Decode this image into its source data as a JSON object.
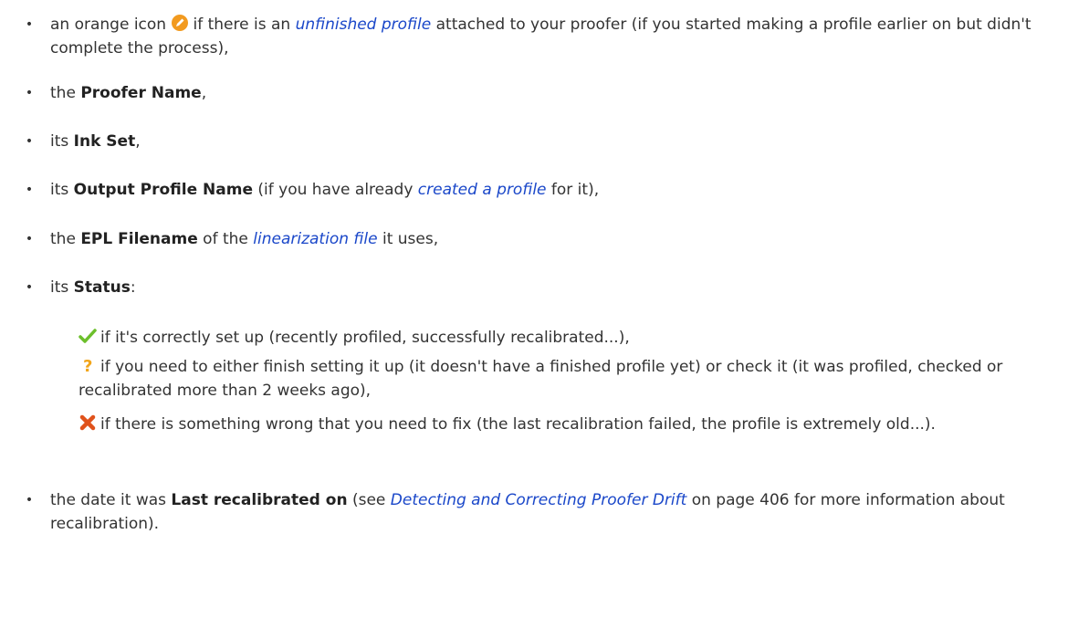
{
  "bullets": [
    {
      "pre": "an orange icon",
      "mid1": "if there is an",
      "link": "unfinished profile",
      "post": "attached to your proofer (if you started making a profile earlier on but didn't complete the process),",
      "icon": "orange-pencil-icon",
      "colors": {
        "icon": "#f29a1f"
      }
    },
    {
      "pre": "the",
      "bold": "Proofer Name",
      "post": ","
    },
    {
      "pre": "its",
      "bold": "Ink Set",
      "post": ","
    },
    {
      "pre": "its",
      "bold": "Output Profile Name",
      "mid": "(if you have already",
      "link": "created a profile",
      "post": "for it),"
    },
    {
      "pre": "the",
      "bold": "EPL Filename",
      "mid": "of the",
      "link": "linearization file",
      "post": "it uses,"
    },
    {
      "pre": "its",
      "bold": "Status",
      "post": ":"
    },
    {
      "pre": "the date it was",
      "bold": "Last recalibrated on",
      "mid": "(see",
      "link": "Detecting and Correcting Proofer Drift",
      "post": "on page 406 for more information about recalibration)."
    }
  ],
  "status_items": [
    {
      "icon": "green-check-icon",
      "text": "if it's correctly set up (recently profiled, successfully recalibrated...),"
    },
    {
      "icon": "question-mark-icon",
      "text": "if you need to either finish setting it up (it doesn't have a finished profile yet) or check it (it was profiled, checked or recalibrated more than 2 weeks ago),"
    },
    {
      "icon": "red-cross-icon",
      "text": "if there is something wrong that you need to fix (the last recalibration failed, the profile is extremely old...)."
    }
  ],
  "bullet_char": "•",
  "colors": {
    "link": "#1a47c9",
    "text": "#333333",
    "check": "#6cbf2b",
    "question": "#f2a51a",
    "cross": "#e0521b"
  }
}
